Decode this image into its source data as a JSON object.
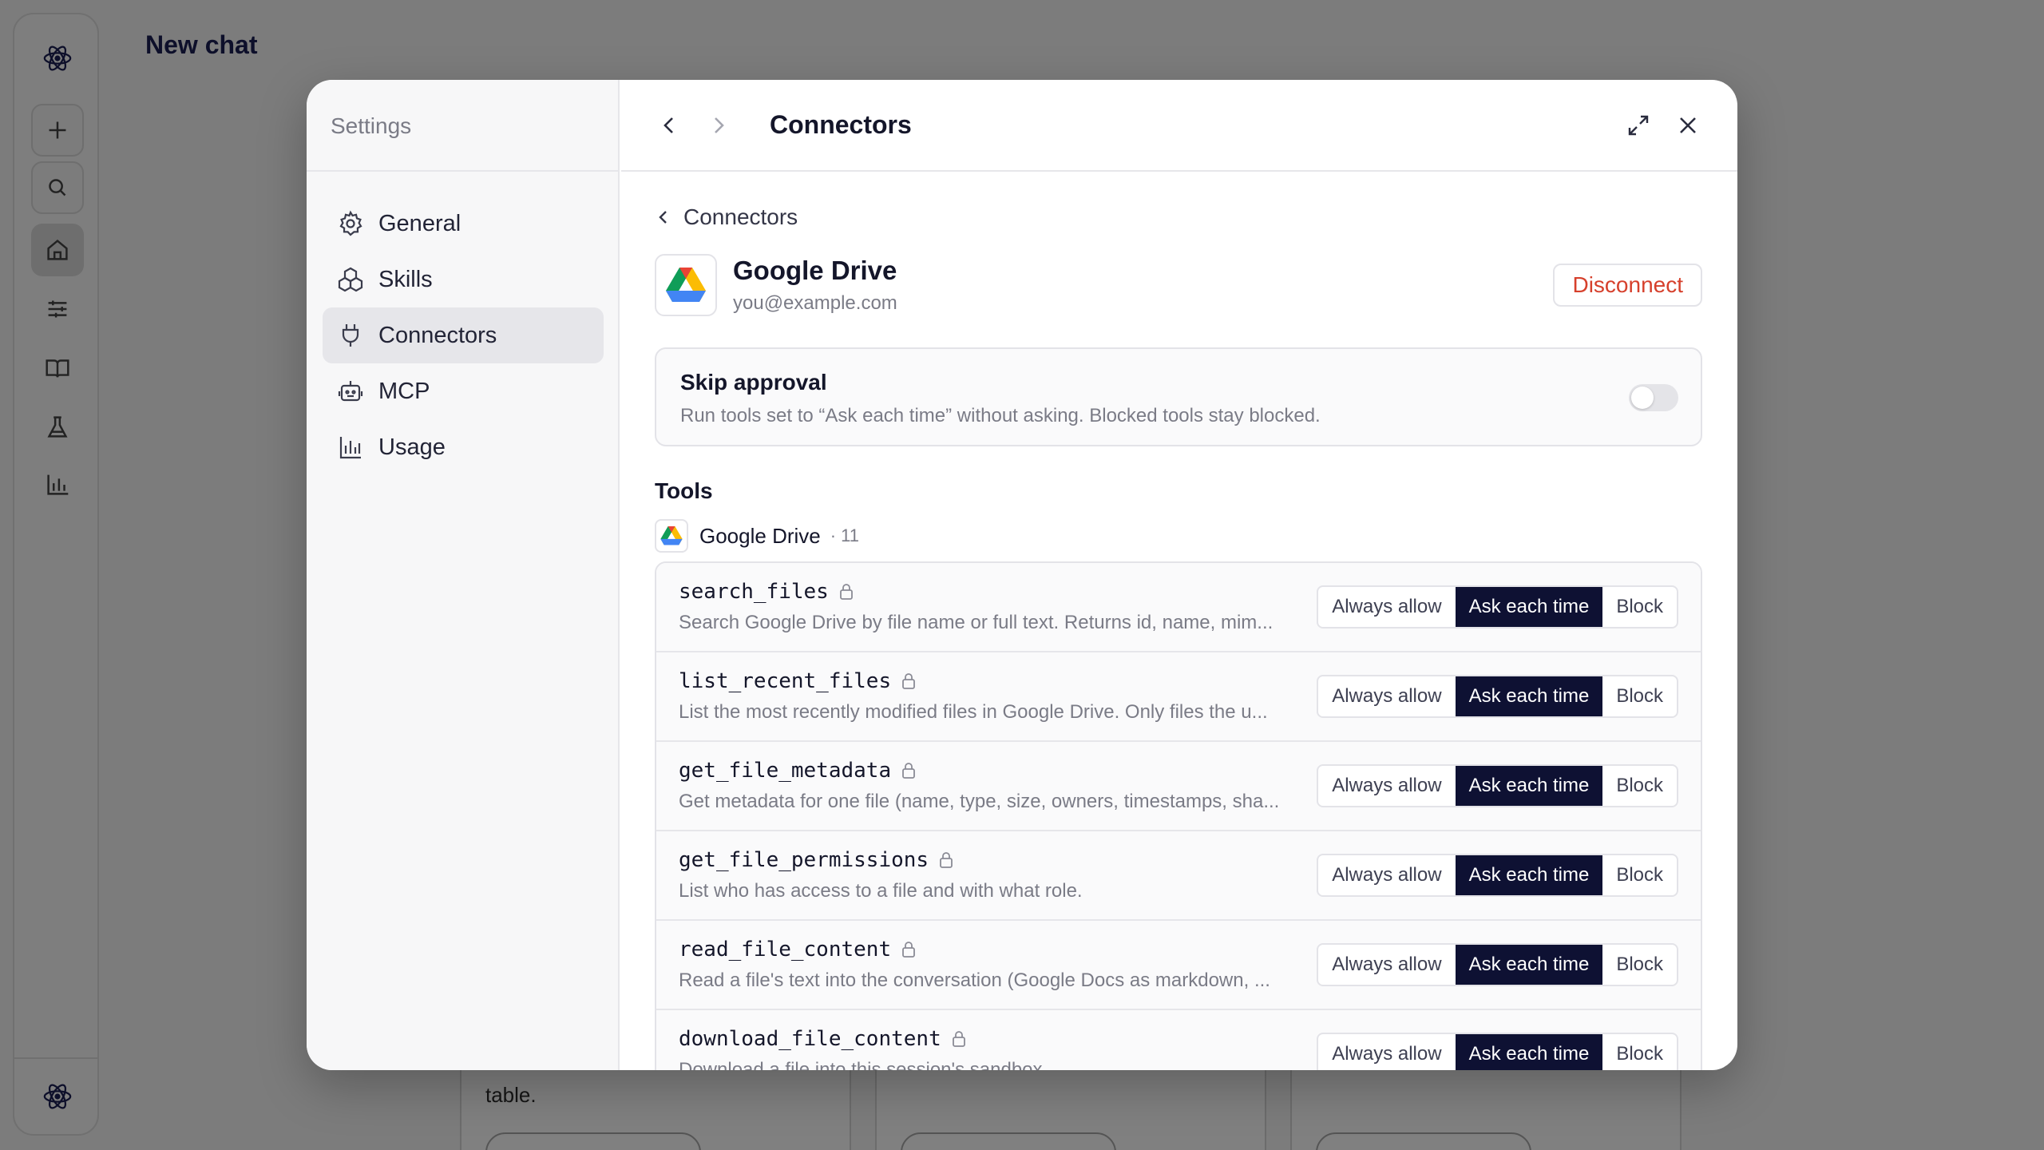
{
  "background": {
    "title": "New chat",
    "cards": [
      {
        "text": "table."
      },
      {
        "text": ""
      },
      {
        "text": ""
      }
    ],
    "rail_icons": [
      "atom-logo-icon",
      "plus-icon",
      "search-icon",
      "home-icon",
      "sliders-icon",
      "book-icon",
      "flask-icon",
      "bar-chart-icon",
      "atom-logo-icon"
    ]
  },
  "settings": {
    "sidebar_title": "Settings",
    "nav": [
      {
        "label": "General",
        "icon": "gear-icon"
      },
      {
        "label": "Skills",
        "icon": "cubes-icon"
      },
      {
        "label": "Connectors",
        "icon": "plug-icon",
        "active": true
      },
      {
        "label": "MCP",
        "icon": "robot-icon"
      },
      {
        "label": "Usage",
        "icon": "bar-chart-icon"
      }
    ],
    "page_title": "Connectors",
    "back_label": "Connectors",
    "connector": {
      "name": "Google Drive",
      "email": "you@example.com",
      "disconnect_label": "Disconnect"
    },
    "skip_approval": {
      "title": "Skip approval",
      "description": "Run tools set to “Ask each time” without asking. Blocked tools stay blocked.",
      "enabled": false
    },
    "tools_label": "Tools",
    "group": {
      "name": "Google Drive",
      "count": "· 11"
    },
    "options": [
      "Always allow",
      "Ask each time",
      "Block"
    ],
    "tools": [
      {
        "name": "search_files",
        "description": "Search Google Drive by file name or full text. Returns id, name, mim...",
        "selected": "Ask each time"
      },
      {
        "name": "list_recent_files",
        "description": "List the most recently modified files in Google Drive. Only files the u...",
        "selected": "Ask each time"
      },
      {
        "name": "get_file_metadata",
        "description": "Get metadata for one file (name, type, size, owners, timestamps, sha...",
        "selected": "Ask each time"
      },
      {
        "name": "get_file_permissions",
        "description": "List who has access to a file and with what role.",
        "selected": "Ask each time"
      },
      {
        "name": "read_file_content",
        "description": "Read a file's text into the conversation (Google Docs as markdown, ...",
        "selected": "Ask each time"
      },
      {
        "name": "download_file_content",
        "description": "Download a file into this session's sandbox ...",
        "selected": "Ask each time"
      }
    ]
  }
}
